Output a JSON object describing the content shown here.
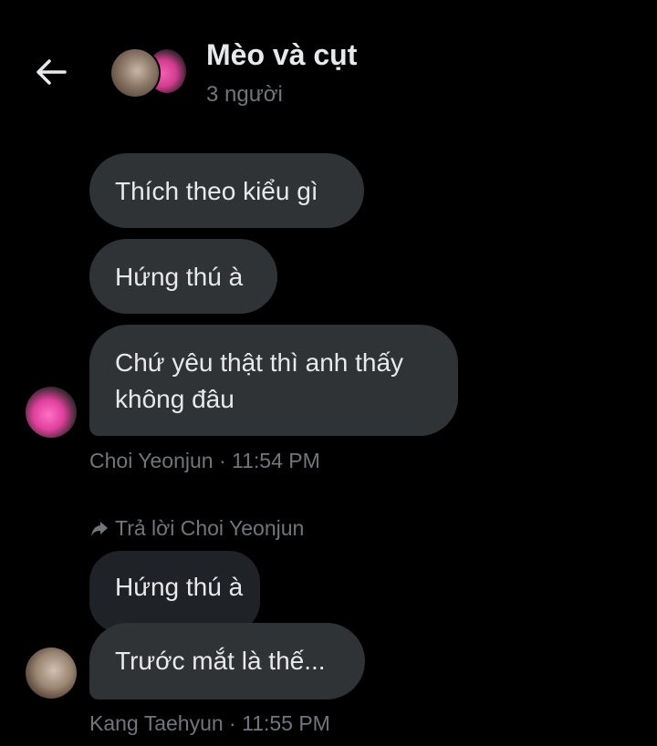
{
  "header": {
    "title": "Mèo và cụt",
    "subtitle": "3 người"
  },
  "messages": [
    {
      "text": "Thích theo kiểu gì"
    },
    {
      "text": "Hứng thú à"
    },
    {
      "text": "Chứ yêu thật thì anh thấy không đâu"
    }
  ],
  "group1_meta": "Choi Yeonjun · 11:54 PM",
  "reply": {
    "label": "Trả lời Choi Yeonjun",
    "quoted_text": "Hứng thú à",
    "text": "Trước mắt là thế..."
  },
  "group2_meta": "Kang Taehyun · 11:55 PM",
  "colors": {
    "background": "#000000",
    "bubble": "#2f3336",
    "quoted_bubble": "#1f2226",
    "primary_text": "#e7e9ea",
    "secondary_text": "#71767b"
  }
}
